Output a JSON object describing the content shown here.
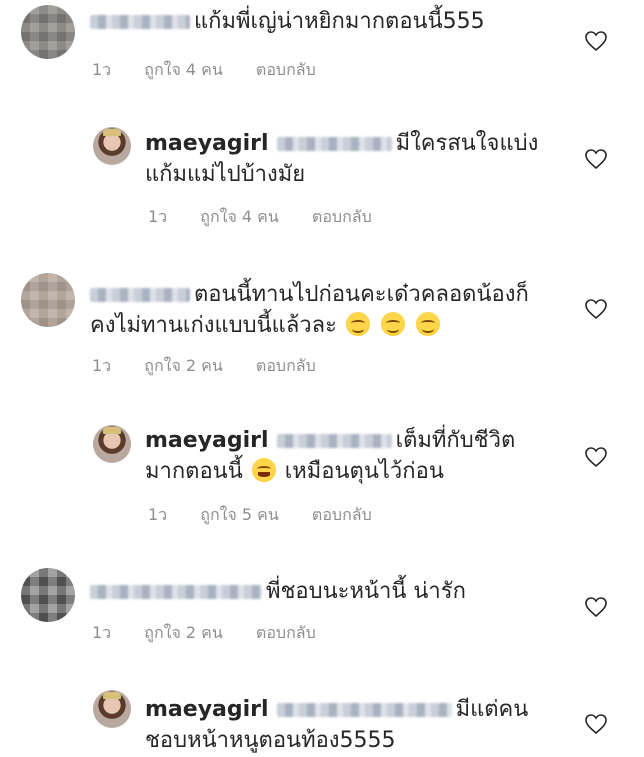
{
  "comments": [
    {
      "kind": "comment",
      "username": "",
      "text": "แก้มพี่เญ่น่าหยิกมากตอนนี้555",
      "time": "1ว",
      "likes": "ถูกใจ 4 คน",
      "reply": "ตอบกลับ"
    },
    {
      "kind": "reply",
      "username": "maeyagirl",
      "text_line1": "มีใครสนใจแบ่ง",
      "text_line2": "แก้มแม่ไปบ้างมัย",
      "time": "1ว",
      "likes": "ถูกใจ 4 คน",
      "reply": "ตอบกลับ"
    },
    {
      "kind": "comment",
      "username": "",
      "text_line1": "ตอนนี้ทานไปก่อนคะเด๋วคลอดน้องก็",
      "text_line2": "คงไม่ทานเก่งแบบนี้แล้วละ",
      "emoji": "smile-emoji x3",
      "time": "1ว",
      "likes": "ถูกใจ 2 คน",
      "reply": "ตอบกลับ"
    },
    {
      "kind": "reply",
      "username": "maeyagirl",
      "text_line1": "เต็มที่กับชีวิต",
      "text_line2a": "มากตอนนี้",
      "text_line2b": "เหมือนตุนไว้ก่อน",
      "emoji": "laughing-tears-emoji",
      "time": "1ว",
      "likes": "ถูกใจ 5 คน",
      "reply": "ตอบกลับ"
    },
    {
      "kind": "comment",
      "username": "",
      "text": "พี่ชอบนะหน้านี้ น่ารัก",
      "time": "1ว",
      "likes": "ถูกใจ 2 คน",
      "reply": "ตอบกลับ"
    },
    {
      "kind": "reply",
      "username": "maeyagirl",
      "text_line1": "มีแต่คน",
      "text_line2": "ชอบหน้าหนูตอนท้อง5555"
    }
  ],
  "colors": {
    "text": "#262626",
    "meta": "#8e8e8e",
    "heart_stroke": "#262626"
  },
  "icons": {
    "like": "heart-outline-icon"
  }
}
